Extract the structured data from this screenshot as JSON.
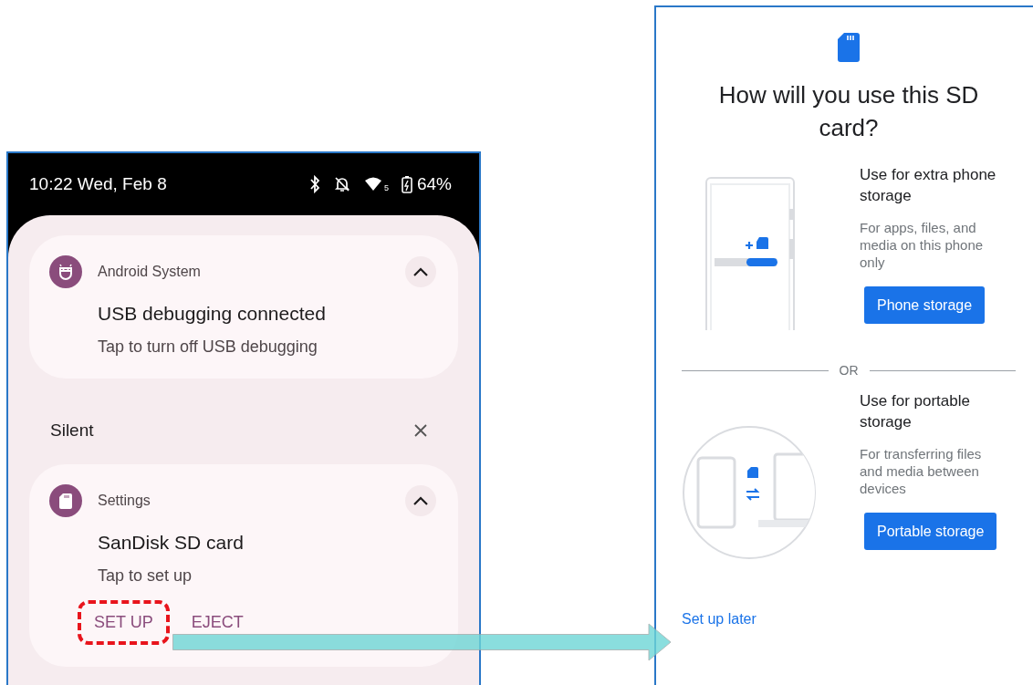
{
  "status_bar": {
    "time": "10:22 Wed, Feb 8",
    "wifi_band": "5",
    "battery": "64%"
  },
  "notifications": [
    {
      "kind": "android",
      "app": "Android System",
      "title": "USB debugging connected",
      "text": "Tap to turn off USB debugging",
      "expanded": true
    }
  ],
  "silent_section": {
    "heading": "Silent",
    "notifications": [
      {
        "kind": "sd",
        "app": "Settings",
        "title": "SanDisk SD card",
        "text": "Tap to set up",
        "expanded": true,
        "actions": [
          {
            "label": "SET UP",
            "highlighted": true
          },
          {
            "label": "EJECT",
            "highlighted": false
          }
        ]
      }
    ]
  },
  "setup_dialog": {
    "title": "How will you use this SD card?",
    "options": [
      {
        "kind": "phone",
        "title": "Use for extra phone storage",
        "description": "For apps, files, and media on this phone only",
        "button": "Phone storage"
      },
      {
        "kind": "portable",
        "title": "Use for portable storage",
        "description": "For transferring files and media between devices",
        "button": "Portable storage"
      }
    ],
    "divider": "OR",
    "link": "Set up later"
  }
}
